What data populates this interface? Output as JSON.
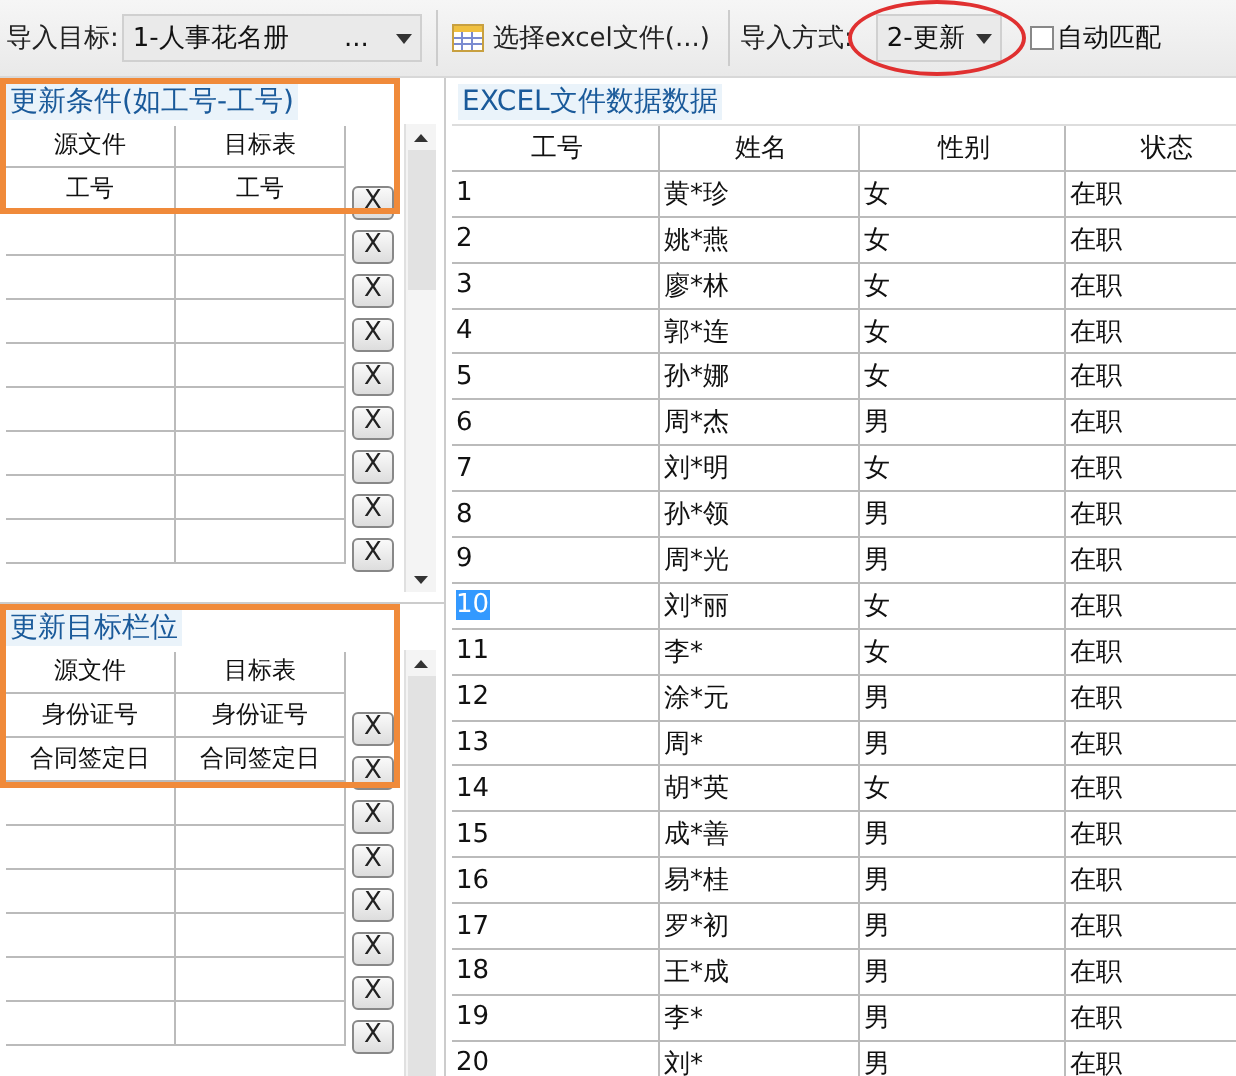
{
  "toolbar": {
    "target_label": "导入目标:",
    "target_value": "1-人事花名册",
    "target_more": "...",
    "file_button": "选择excel文件(...)",
    "mode_label": "导入方式:",
    "mode_value": "2-更新",
    "auto_match": {
      "label": "自动匹配",
      "checked": false
    }
  },
  "condition_panel": {
    "title": "更新条件(如工号-工号)",
    "columns": [
      "源文件",
      "目标表"
    ],
    "rows": [
      {
        "source": "工号",
        "target": "工号",
        "button": "X"
      },
      {
        "button": "X"
      },
      {
        "button": "X"
      },
      {
        "button": "X"
      },
      {
        "button": "X"
      },
      {
        "button": "X"
      },
      {
        "button": "X"
      },
      {
        "button": "X"
      },
      {
        "button": "X"
      }
    ]
  },
  "target_panel": {
    "title": "更新目标栏位",
    "columns": [
      "源文件",
      "目标表"
    ],
    "rows": [
      {
        "source": "身份证号",
        "target": "身份证号",
        "button": "X"
      },
      {
        "source": "合同签定日",
        "target": "合同签定日",
        "button": "X"
      },
      {
        "button": "X"
      },
      {
        "button": "X"
      },
      {
        "button": "X"
      },
      {
        "button": "X"
      },
      {
        "button": "X"
      },
      {
        "button": "X"
      }
    ]
  },
  "excel_panel": {
    "title": "EXCEL文件数据数据",
    "columns": [
      "工号",
      "姓名",
      "性别",
      "状态"
    ],
    "rows": [
      {
        "cells": [
          "1",
          "黄*珍",
          "女",
          "在职"
        ],
        "selected": false
      },
      {
        "cells": [
          "2",
          "姚*燕",
          "女",
          "在职"
        ],
        "selected": false
      },
      {
        "cells": [
          "3",
          "廖*林",
          "女",
          "在职"
        ],
        "selected": false
      },
      {
        "cells": [
          "4",
          "郭*连",
          "女",
          "在职"
        ],
        "selected": false
      },
      {
        "cells": [
          "5",
          "孙*娜",
          "女",
          "在职"
        ],
        "selected": false
      },
      {
        "cells": [
          "6",
          "周*杰",
          "男",
          "在职"
        ],
        "selected": false
      },
      {
        "cells": [
          "7",
          "刘*明",
          "女",
          "在职"
        ],
        "selected": false
      },
      {
        "cells": [
          "8",
          "孙*领",
          "男",
          "在职"
        ],
        "selected": false
      },
      {
        "cells": [
          "9",
          "周*光",
          "男",
          "在职"
        ],
        "selected": false
      },
      {
        "cells": [
          "10",
          "刘*丽",
          "女",
          "在职"
        ],
        "selected": true
      },
      {
        "cells": [
          "11",
          "李*",
          "女",
          "在职"
        ],
        "selected": false
      },
      {
        "cells": [
          "12",
          "涂*元",
          "男",
          "在职"
        ],
        "selected": false
      },
      {
        "cells": [
          "13",
          "周*",
          "男",
          "在职"
        ],
        "selected": false
      },
      {
        "cells": [
          "14",
          "胡*英",
          "女",
          "在职"
        ],
        "selected": false
      },
      {
        "cells": [
          "15",
          "成*善",
          "男",
          "在职"
        ],
        "selected": false
      },
      {
        "cells": [
          "16",
          "易*桂",
          "男",
          "在职"
        ],
        "selected": false
      },
      {
        "cells": [
          "17",
          "罗*初",
          "男",
          "在职"
        ],
        "selected": false
      },
      {
        "cells": [
          "18",
          "王*成",
          "男",
          "在职"
        ],
        "selected": false
      },
      {
        "cells": [
          "19",
          "李*",
          "男",
          "在职"
        ],
        "selected": false
      },
      {
        "cells": [
          "20",
          "刘*",
          "男",
          "在职"
        ],
        "selected": false
      }
    ]
  }
}
